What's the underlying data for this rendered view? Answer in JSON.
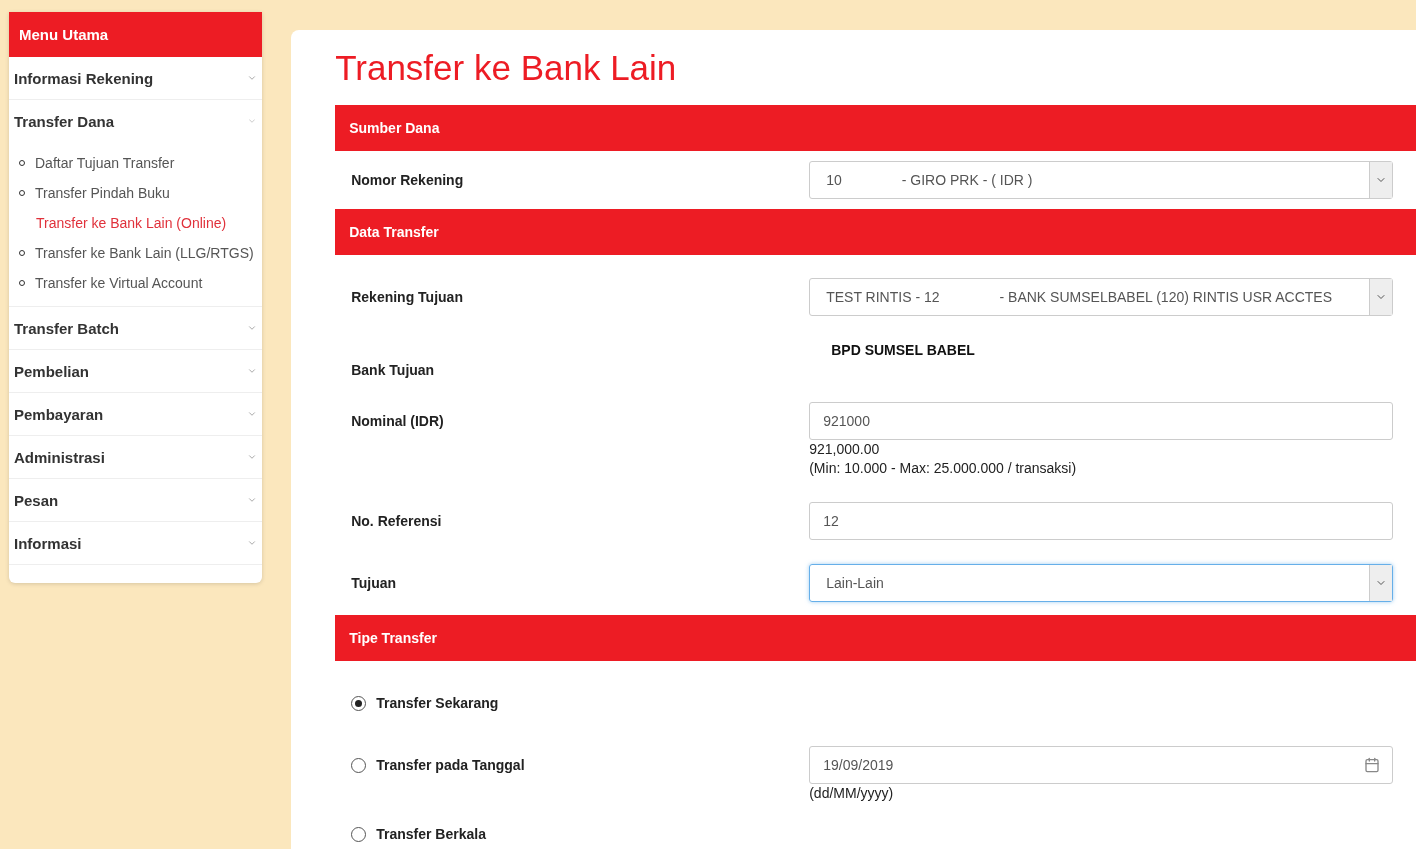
{
  "sidebar": {
    "title": "Menu Utama",
    "items": [
      {
        "label": "Informasi Rekening",
        "expanded": false
      },
      {
        "label": "Transfer Dana",
        "expanded": true,
        "children": [
          {
            "label": "Daftar Tujuan Transfer",
            "selected": false
          },
          {
            "label": "Transfer Pindah Buku",
            "selected": false
          },
          {
            "label": "Transfer ke Bank Lain (Online)",
            "selected": true
          },
          {
            "label": "Transfer ke Bank Lain (LLG/RTGS)",
            "selected": false
          },
          {
            "label": "Transfer ke Virtual Account",
            "selected": false
          }
        ]
      },
      {
        "label": "Transfer Batch",
        "expanded": false
      },
      {
        "label": "Pembelian",
        "expanded": false
      },
      {
        "label": "Pembayaran",
        "expanded": false
      },
      {
        "label": "Administrasi",
        "expanded": false
      },
      {
        "label": "Pesan",
        "expanded": false
      },
      {
        "label": "Informasi",
        "expanded": false
      }
    ]
  },
  "page": {
    "title": "Transfer ke Bank Lain"
  },
  "sections": [
    {
      "title": "Sumber Dana",
      "rows": [
        {
          "kind": "select",
          "label": "Nomor Rekening",
          "value": "10",
          "detail": "- GIRO PRK - ( IDR )",
          "focused": false
        }
      ]
    },
    {
      "title": "Data Transfer",
      "rows": [
        {
          "kind": "select",
          "label": "Rekening Tujuan",
          "value": "TEST RINTIS - 12",
          "detail": "- BANK SUMSELBABEL (120) RINTIS USR ACCTES",
          "focused": false
        },
        {
          "kind": "static",
          "label": "Bank Tujuan",
          "value": "BPD SUMSEL BABEL"
        },
        {
          "kind": "text",
          "label": "Nominal (IDR)",
          "value": "921000",
          "notes": [
            "921,000.00",
            "(Min: 10.000 - Max: 25.000.000 / transaksi)"
          ]
        },
        {
          "kind": "text",
          "label": "No. Referensi",
          "value": "12"
        },
        {
          "kind": "select",
          "label": "Tujuan",
          "value": "Lain-Lain",
          "focused": true
        }
      ]
    },
    {
      "title": "Tipe Transfer",
      "rows": [
        {
          "kind": "radio",
          "label": "Transfer Sekarang",
          "selected": true
        },
        {
          "kind": "radio",
          "label": "Transfer pada Tanggal",
          "selected": false,
          "date": {
            "value": "19/09/2019",
            "hint": "(dd/MM/yyyy)"
          }
        },
        {
          "kind": "radio",
          "label": "Transfer Berkala",
          "selected": false
        }
      ]
    }
  ]
}
